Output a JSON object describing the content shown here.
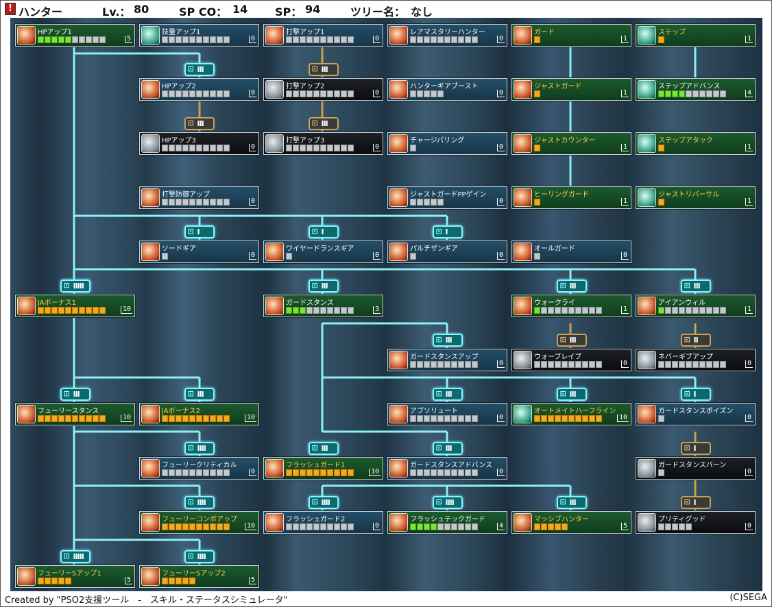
{
  "header": {
    "class_name": "ハンター",
    "lv_label": "Lv.：",
    "lv_value": "80",
    "spco_label": "SP CO：",
    "spco_value": "14",
    "sp_label": "SP：",
    "sp_value": "94",
    "tree_label": "ツリー名：",
    "tree_value": "なし"
  },
  "footer": {
    "credit": "Created by \"PSO2支援ツール　-　スキル・ステータスシミュレータ\"",
    "copyright": "(C)SEGA"
  },
  "skills": [
    {
      "name": "HPアップ1",
      "level": "5",
      "max": 10,
      "filled": 5,
      "color": "green",
      "fill": "on",
      "col": 0,
      "row": 0,
      "icon": "hp-icon"
    },
    {
      "name": "技量アップ1",
      "level": "0",
      "max": 10,
      "filled": 0,
      "color": "blue",
      "col": 1,
      "row": 0,
      "icon": "dexterity-icon"
    },
    {
      "name": "打撃アップ1",
      "level": "0",
      "max": 10,
      "filled": 0,
      "color": "blue",
      "col": 2,
      "row": 0,
      "icon": "sword-icon"
    },
    {
      "name": "レアマスタリーハンター",
      "level": "0",
      "max": 10,
      "filled": 0,
      "color": "blue",
      "col": 3,
      "row": 0,
      "icon": "rare-mastery-icon"
    },
    {
      "name": "ガード",
      "level": "1",
      "max": 1,
      "filled": 1,
      "color": "green",
      "fill": "or",
      "col": 4,
      "row": 0,
      "icon": "guard-icon",
      "yellow": true
    },
    {
      "name": "ステップ",
      "level": "1",
      "max": 1,
      "filled": 1,
      "color": "green",
      "fill": "or",
      "col": 5,
      "row": 0,
      "icon": "step-icon",
      "yellow": true
    },
    {
      "name": "HPアップ2",
      "level": "0",
      "max": 10,
      "filled": 0,
      "color": "blue",
      "col": 1,
      "row": 1,
      "icon": "hp-icon"
    },
    {
      "name": "打撃アップ2",
      "level": "0",
      "max": 10,
      "filled": 0,
      "color": "dark",
      "col": 2,
      "row": 1,
      "icon": "sword-icon"
    },
    {
      "name": "ハンターギアブースト",
      "level": "0",
      "max": 5,
      "filled": 0,
      "color": "blue",
      "col": 3,
      "row": 1,
      "icon": "gear-boost-icon"
    },
    {
      "name": "ジャストガード",
      "level": "1",
      "max": 1,
      "filled": 1,
      "color": "green",
      "fill": "or",
      "col": 4,
      "row": 1,
      "icon": "guard-icon",
      "yellow": true
    },
    {
      "name": "ステップアドバンス",
      "level": "4",
      "max": 10,
      "filled": 4,
      "color": "green",
      "fill": "on",
      "col": 5,
      "row": 1,
      "icon": "step-icon"
    },
    {
      "name": "HPアップ3",
      "level": "0",
      "max": 10,
      "filled": 0,
      "color": "dark",
      "col": 1,
      "row": 2,
      "icon": "hp-icon"
    },
    {
      "name": "打撃アップ3",
      "level": "0",
      "max": 10,
      "filled": 0,
      "color": "dark",
      "col": 2,
      "row": 2,
      "icon": "sword-icon"
    },
    {
      "name": "チャージパリング",
      "level": "0",
      "max": 1,
      "filled": 0,
      "color": "blue",
      "col": 3,
      "row": 2,
      "icon": "parry-icon"
    },
    {
      "name": "ジャストカウンター",
      "level": "1",
      "max": 1,
      "filled": 1,
      "color": "green",
      "fill": "or",
      "col": 4,
      "row": 2,
      "icon": "guard-icon",
      "yellow": true
    },
    {
      "name": "ステップアタック",
      "level": "1",
      "max": 1,
      "filled": 1,
      "color": "green",
      "fill": "or",
      "col": 5,
      "row": 2,
      "icon": "step-icon",
      "yellow": true
    },
    {
      "name": "打撃防御アップ",
      "level": "0",
      "max": 10,
      "filled": 0,
      "color": "blue",
      "col": 1,
      "row": 3,
      "icon": "defense-icon"
    },
    {
      "name": "ジャストガードPPゲイン",
      "level": "0",
      "max": 5,
      "filled": 0,
      "color": "blue",
      "col": 3,
      "row": 3,
      "icon": "pp-gain-icon"
    },
    {
      "name": "ヒーリングガード",
      "level": "1",
      "max": 1,
      "filled": 1,
      "color": "green",
      "fill": "or",
      "col": 4,
      "row": 3,
      "icon": "healing-guard-icon",
      "yellow": true
    },
    {
      "name": "ジャストリバーサル",
      "level": "1",
      "max": 1,
      "filled": 1,
      "color": "green",
      "fill": "or",
      "col": 5,
      "row": 3,
      "icon": "step-icon",
      "yellow": true
    },
    {
      "name": "ソードギア",
      "level": "0",
      "max": 1,
      "filled": 0,
      "color": "blue",
      "col": 1,
      "row": 4,
      "icon": "sword-gear-icon"
    },
    {
      "name": "ワイヤードランスギア",
      "level": "0",
      "max": 1,
      "filled": 0,
      "color": "blue",
      "col": 2,
      "row": 4,
      "icon": "lance-gear-icon"
    },
    {
      "name": "パルチザンギア",
      "level": "0",
      "max": 1,
      "filled": 0,
      "color": "blue",
      "col": 3,
      "row": 4,
      "icon": "partisan-gear-icon"
    },
    {
      "name": "オールガード",
      "level": "0",
      "max": 1,
      "filled": 0,
      "color": "blue",
      "col": 4,
      "row": 4,
      "icon": "all-guard-icon"
    },
    {
      "name": "JAボーナス1",
      "level": "10",
      "max": 10,
      "filled": 10,
      "color": "green",
      "fill": "or",
      "col": 0,
      "row": 5,
      "icon": "ja-bonus-icon",
      "yellow": true
    },
    {
      "name": "ガードスタンス",
      "level": "3",
      "max": 10,
      "filled": 3,
      "color": "green",
      "fill": "on",
      "col": 2,
      "row": 5,
      "icon": "guard-stance-icon"
    },
    {
      "name": "ウォークライ",
      "level": "1",
      "max": 10,
      "filled": 1,
      "color": "green",
      "fill": "on",
      "col": 4,
      "row": 5,
      "icon": "war-cry-icon"
    },
    {
      "name": "アイアンウィル",
      "level": "1",
      "max": 10,
      "filled": 1,
      "color": "green",
      "fill": "on",
      "col": 5,
      "row": 5,
      "icon": "iron-will-icon"
    },
    {
      "name": "ガードスタンスアップ",
      "level": "0",
      "max": 10,
      "filled": 0,
      "color": "blue",
      "col": 3,
      "row": 6,
      "icon": "guard-stance-icon"
    },
    {
      "name": "ウォーブレイブ",
      "level": "0",
      "max": 10,
      "filled": 0,
      "color": "dark",
      "col": 4,
      "row": 6,
      "icon": "war-brave-icon"
    },
    {
      "name": "ネバーギブアップ",
      "level": "0",
      "max": 10,
      "filled": 0,
      "color": "dark",
      "col": 5,
      "row": 6,
      "icon": "never-give-up-icon"
    },
    {
      "name": "フューリースタンス",
      "level": "10",
      "max": 10,
      "filled": 10,
      "color": "green",
      "fill": "or",
      "col": 0,
      "row": 7,
      "icon": "fury-stance-icon"
    },
    {
      "name": "JAボーナス2",
      "level": "10",
      "max": 10,
      "filled": 10,
      "color": "green",
      "fill": "or",
      "col": 1,
      "row": 7,
      "icon": "ja-bonus-icon",
      "yellow": true
    },
    {
      "name": "アブソリュート",
      "level": "0",
      "max": 10,
      "filled": 0,
      "color": "blue",
      "col": 3,
      "row": 7,
      "icon": "absorption-icon"
    },
    {
      "name": "オートメイトハーフライン",
      "level": "10",
      "max": 10,
      "filled": 10,
      "color": "green",
      "fill": "or",
      "col": 4,
      "row": 7,
      "icon": "automate-icon",
      "yellow": true
    },
    {
      "name": "ガードスタンスポイズン",
      "level": "0",
      "max": 1,
      "filled": 0,
      "color": "blue",
      "col": 5,
      "row": 7,
      "icon": "guard-stance-icon"
    },
    {
      "name": "フューリークリティカル",
      "level": "0",
      "max": 10,
      "filled": 0,
      "color": "blue",
      "col": 1,
      "row": 8,
      "icon": "fury-critical-icon"
    },
    {
      "name": "フラッシュガード1",
      "level": "10",
      "max": 10,
      "filled": 10,
      "color": "green",
      "fill": "or",
      "col": 2,
      "row": 8,
      "icon": "flash-guard-icon",
      "yellow": true
    },
    {
      "name": "ガードスタンスアドバンス",
      "level": "0",
      "max": 10,
      "filled": 0,
      "color": "blue",
      "col": 3,
      "row": 8,
      "icon": "guard-stance-icon"
    },
    {
      "name": "ガードスタンスバーン",
      "level": "0",
      "max": 1,
      "filled": 0,
      "color": "dark",
      "col": 5,
      "row": 8,
      "icon": "guard-stance-icon"
    },
    {
      "name": "フューリーコンボアップ",
      "level": "10",
      "max": 10,
      "filled": 10,
      "color": "green",
      "fill": "or",
      "col": 1,
      "row": 9,
      "icon": "fury-combo-icon",
      "yellow": true
    },
    {
      "name": "フラッシュガード2",
      "level": "0",
      "max": 10,
      "filled": 0,
      "color": "blue",
      "col": 2,
      "row": 9,
      "icon": "flash-guard-icon"
    },
    {
      "name": "フラッシュテックガード",
      "level": "4",
      "max": 10,
      "filled": 4,
      "color": "green",
      "fill": "on",
      "col": 3,
      "row": 9,
      "icon": "flash-tech-guard-icon"
    },
    {
      "name": "マッシブハンター",
      "level": "5",
      "max": 5,
      "filled": 5,
      "color": "green",
      "fill": "or",
      "col": 4,
      "row": 9,
      "icon": "massive-hunter-icon",
      "yellow": true
    },
    {
      "name": "プリティグッド",
      "level": "0",
      "max": 5,
      "filled": 0,
      "color": "dark",
      "col": 5,
      "row": 9,
      "icon": "pretty-good-icon"
    },
    {
      "name": "フューリーSアップ1",
      "level": "5",
      "max": 5,
      "filled": 5,
      "color": "green",
      "fill": "or",
      "col": 0,
      "row": 10,
      "icon": "fury-s-icon",
      "yellow": true
    },
    {
      "name": "フューリーSアップ2",
      "level": "5",
      "max": 5,
      "filled": 5,
      "color": "green",
      "fill": "or",
      "col": 1,
      "row": 10,
      "icon": "fury-s-icon",
      "yellow": true
    }
  ],
  "locks": [
    {
      "col": 1,
      "row": 0,
      "text": "III",
      "active": true
    },
    {
      "col": 2,
      "row": 0,
      "text": "III",
      "active": false
    },
    {
      "col": 1,
      "row": 1,
      "text": "III",
      "active": false
    },
    {
      "col": 2,
      "row": 1,
      "text": "III",
      "active": false
    },
    {
      "col": 1,
      "row": 3,
      "text": "I",
      "active": true
    },
    {
      "col": 2,
      "row": 3,
      "text": "I",
      "active": true
    },
    {
      "col": 3,
      "row": 3,
      "text": "I",
      "active": true
    },
    {
      "col": 0,
      "row": 4,
      "text": "IIIII",
      "active": true
    },
    {
      "col": 2,
      "row": 4,
      "text": "III",
      "active": true
    },
    {
      "col": 4,
      "row": 4,
      "text": "III",
      "active": true
    },
    {
      "col": 5,
      "row": 4,
      "text": "III",
      "active": true
    },
    {
      "col": 3,
      "row": 5,
      "text": "III",
      "active": true
    },
    {
      "col": 4,
      "row": 5,
      "text": "III",
      "active": false
    },
    {
      "col": 5,
      "row": 5,
      "text": "II",
      "active": false
    },
    {
      "col": 0,
      "row": 6,
      "text": "III",
      "active": true
    },
    {
      "col": 1,
      "row": 6,
      "text": "III",
      "active": true
    },
    {
      "col": 3,
      "row": 6,
      "text": "III",
      "active": true
    },
    {
      "col": 4,
      "row": 6,
      "text": "III",
      "active": true
    },
    {
      "col": 5,
      "row": 6,
      "text": "I",
      "active": true
    },
    {
      "col": 1,
      "row": 7,
      "text": "IIII",
      "active": true
    },
    {
      "col": 2,
      "row": 7,
      "text": "III",
      "active": true
    },
    {
      "col": 3,
      "row": 7,
      "text": "III",
      "active": true
    },
    {
      "col": 5,
      "row": 7,
      "text": "I",
      "active": false
    },
    {
      "col": 1,
      "row": 8,
      "text": "IIII",
      "active": true
    },
    {
      "col": 2,
      "row": 8,
      "text": "IIII",
      "active": true
    },
    {
      "col": 3,
      "row": 8,
      "text": "IIII",
      "active": true
    },
    {
      "col": 4,
      "row": 8,
      "text": "III",
      "active": true
    },
    {
      "col": 5,
      "row": 8,
      "text": "I",
      "active": false
    },
    {
      "col": 0,
      "row": 9,
      "text": "IIIII",
      "active": true
    },
    {
      "col": 1,
      "row": 9,
      "text": "IIII",
      "active": true
    }
  ]
}
